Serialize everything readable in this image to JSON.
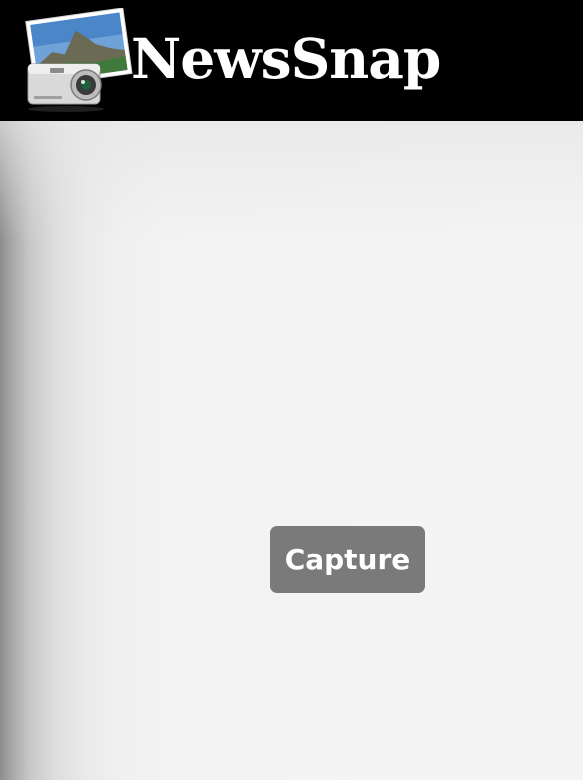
{
  "header": {
    "app_title": "NewsSnap",
    "logo_icon": "camera-photo-icon",
    "background_color": "#000000"
  },
  "main": {
    "capture_label": "Capture",
    "button_color": "#7a7a7a"
  }
}
